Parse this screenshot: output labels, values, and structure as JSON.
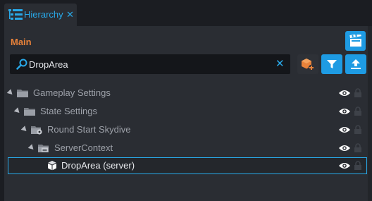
{
  "tab": {
    "label": "Hierarchy",
    "close": "✕"
  },
  "section": {
    "title": "Main"
  },
  "search": {
    "value": "DropArea",
    "clear": "✕"
  },
  "tree": {
    "items": [
      {
        "label": "Gameplay Settings",
        "icon": "folder-icon"
      },
      {
        "label": "State Settings",
        "icon": "folder-icon"
      },
      {
        "label": "Round Start Skydive",
        "icon": "folder-gear-icon"
      },
      {
        "label": "ServerContext",
        "icon": "server-context-icon"
      },
      {
        "label": "DropArea (server)",
        "icon": "cube-icon"
      }
    ]
  },
  "colors": {
    "accent": "#1e9be3",
    "title": "#e8823a",
    "selection": "#28a8e8"
  }
}
